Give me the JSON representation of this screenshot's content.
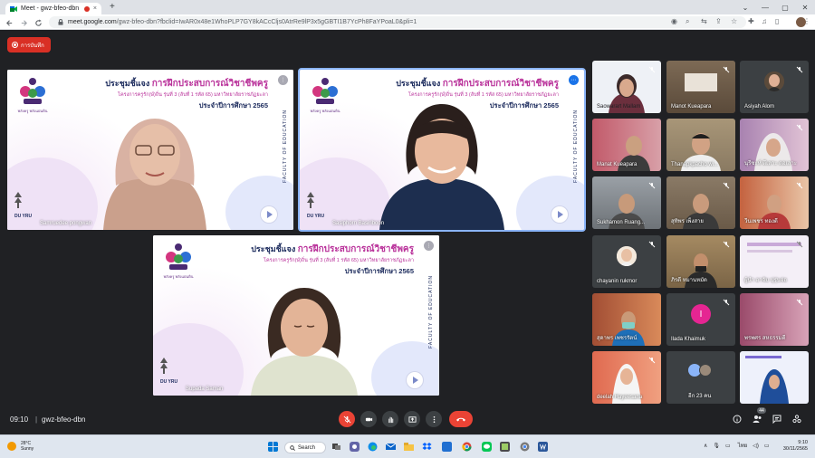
{
  "browser": {
    "tab_title": "Meet - gwz-bfeo-dbn",
    "tab_close": "×",
    "new_tab": "+",
    "url_domain": "meet.google.com",
    "url_path": "/gwz-bfeo-dbn?fbclid=IwAR0x48e1WhoPLP7GY8kACcCljs0AtrRe9lP3x5gGBTI1B7YcPh8FaYPoaL0&pli=1",
    "window_controls": [
      "⌄",
      "—",
      "▢",
      "✕"
    ]
  },
  "meet": {
    "record_label": "การบันทึก",
    "time": "09:10",
    "separator": "|",
    "meeting_code": "gwz-bfeo-dbn",
    "participant_count_badge": "44"
  },
  "slide": {
    "logo_caption": "พลังครู พลังแผ่นดิน",
    "heading_prefix": "ประชุมชี้แจง ",
    "heading_main": "การฝึกประสบการณ์วิชาชีพครู",
    "subheading": "โครงการครูรัก(ษ์)ถิ่น รุ่นที่ 3 (ลับที่ 1 รหัส 65) มหาวิทยาลัยราชภัฏยะลา",
    "year_line": "ประจำปีการศึกษา 2565",
    "faculty_vertical": "FACULTY OF EDUCATION",
    "brand": "DU YRU"
  },
  "main_tiles": [
    {
      "name": "Samruedee pongwan",
      "badge": "⋮"
    },
    {
      "name": "Sasiphorn Basiriboon",
      "badge": "⋯"
    },
    {
      "name": "Supada Saman",
      "badge": "⋮"
    }
  ],
  "side_tiles": [
    {
      "name": "Saowarart Mallam",
      "bg": "#e9edf2"
    },
    {
      "name": "Manot Kueapara",
      "bg": "#6e5b48"
    },
    {
      "name": "Asiyah Alom",
      "bg": "#3c4043",
      "avatar": true
    },
    {
      "name": "Manat Kueapara",
      "bg": "#b84d5a"
    },
    {
      "name": "Thanapkpacho wi...",
      "bg": "#9b8a70"
    },
    {
      "name": "นุรีซะห์ ตีเลาะ ดอเลาะ",
      "bg": "#c9b8cc"
    },
    {
      "name": "Sukhamon Ruang...",
      "bg": "#8a8f95"
    },
    {
      "name": "สุทิพร เพ็งสาย",
      "bg": "#7a6a58"
    },
    {
      "name": "วีนเพชร ทองดี",
      "bg": "#c45a3e"
    },
    {
      "name": "chayanin rukmor",
      "bg": "#3c4043",
      "avatar": true
    },
    {
      "name": "ภิรดี หมานหมัด",
      "bg": "#8d7552"
    },
    {
      "name": "ผู้นำ อาจัม ปุรุ่นจ่อ",
      "bg": "#f2eef5"
    },
    {
      "name": "สุดาพร เพชรรัตน์",
      "bg": "#b55a3b"
    },
    {
      "name": "Ilada Khaimuk",
      "bg": "#3c4043",
      "letter": "I"
    },
    {
      "name": "พรพศร สหธรรมดี",
      "bg": "#b45a7a"
    },
    {
      "name": "deelah Hayeesana",
      "bg": "#d65a48"
    },
    {
      "name": "อีก 23 คน",
      "bg": "#3c4043",
      "others": true
    },
    {
      "name": "",
      "bg": "#eef1fb"
    }
  ],
  "taskbar": {
    "temperature": "28°C",
    "weather": "Sunny",
    "search_label": "Search",
    "lang": "ไทย",
    "clock_time": "9:10",
    "clock_date": "30/11/2565"
  },
  "colors": {
    "accent_red": "#d93025",
    "meet_bg": "#202124",
    "tile_bg": "#3c4043"
  }
}
